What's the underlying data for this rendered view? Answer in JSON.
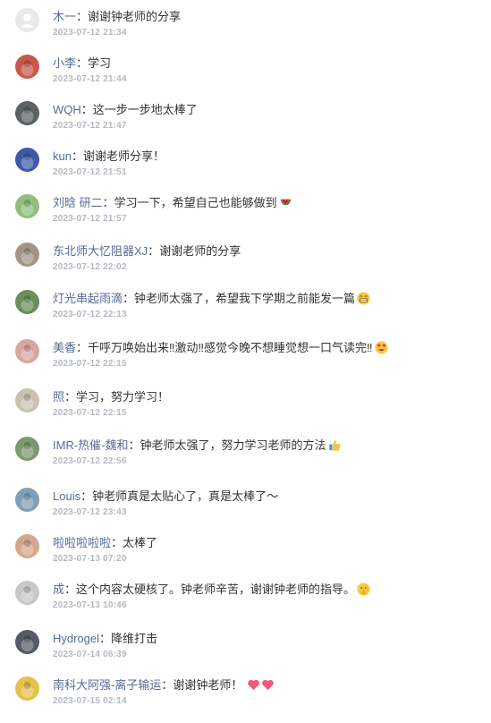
{
  "comments": [
    {
      "name": "木一",
      "text": "谢谢钟老师的分享",
      "time": "2023-07-12 21:34",
      "avatar_color": "#e6e6e6",
      "avatar_icon": "default-person-icon"
    },
    {
      "name": "小李",
      "text": "学习",
      "time": "2023-07-12 21:44",
      "avatar_color": "#c8574a",
      "avatar_icon": "bear-avatar-icon"
    },
    {
      "name": "WQH",
      "text": "这一步一步地太棒了",
      "time": "2023-07-12 21:47",
      "avatar_color": "#5c6163",
      "avatar_icon": "cat-avatar-icon"
    },
    {
      "name": "kun",
      "text": "谢谢老师分享！",
      "time": "2023-07-12 21:51",
      "avatar_color": "#3d5aa8",
      "avatar_icon": "photo-avatar-icon"
    },
    {
      "name": "刘晗 研二",
      "text": "学习一下，希望自己也能够做到",
      "time": "2023-07-12 21:57",
      "avatar_color": "#8fbf7a",
      "avatar_icon": "plant-avatar-icon",
      "emoji": "watermelon-emoji-icon"
    },
    {
      "name": "东北师大忆阻器XJ",
      "text": "谢谢老师的分享",
      "time": "2023-07-12 22:02",
      "avatar_color": "#a39585",
      "avatar_icon": "photo-avatar-icon"
    },
    {
      "name": "灯光串起雨滴",
      "text": "钟老师太强了，希望我下学期之前能发一篇",
      "time": "2023-07-12 22:13",
      "avatar_color": "#6a8f5a",
      "avatar_icon": "landscape-avatar-icon",
      "emoji": "grin-emoji-icon"
    },
    {
      "name": "美香",
      "text": "千呼万唤始出来‼激动‼感觉今晚不想睡觉想一口气读完‼",
      "time": "2023-07-12 22:15",
      "avatar_color": "#d9a5a0",
      "avatar_icon": "portrait-avatar-icon",
      "emoji": "heart-eyes-emoji-icon"
    },
    {
      "name": "照",
      "text": "学习，努力学习！",
      "time": "2023-07-12 22:15",
      "avatar_color": "#c9c1b0",
      "avatar_icon": "photo-avatar-icon"
    },
    {
      "name": "IMR-热催-魏和",
      "text": "钟老师太强了，努力学习老师的方法",
      "time": "2023-07-12 22:56",
      "avatar_color": "#7a9a6e",
      "avatar_icon": "photo-avatar-icon",
      "emoji": "thumbs-up-emoji-icon"
    },
    {
      "name": "Louis",
      "text": "钟老师真是太贴心了，真是太棒了～",
      "time": "2023-07-12 23:43",
      "avatar_color": "#7f9fb8",
      "avatar_icon": "city-avatar-icon"
    },
    {
      "name": "啦啦啦啦啦",
      "text": "太棒了",
      "time": "2023-07-13 07:20",
      "avatar_color": "#d3a88a",
      "avatar_icon": "sky-avatar-icon"
    },
    {
      "name": "成",
      "text": "这个内容太硬核了。钟老师辛苦，谢谢钟老师的指导。",
      "time": "2023-07-13 10:46",
      "avatar_color": "#c8c8c8",
      "avatar_icon": "photo-avatar-icon",
      "emoji": "shush-emoji-icon"
    },
    {
      "name": "Hydrogel",
      "text": "降维打击",
      "time": "2023-07-14 06:39",
      "avatar_color": "#555a66",
      "avatar_icon": "photo-avatar-icon"
    },
    {
      "name": "南科大阿强-离子输运",
      "text": "谢谢钟老师！",
      "time": "2023-07-15 02:14",
      "avatar_color": "#e3c14a",
      "avatar_icon": "pikachu-avatar-icon",
      "emoji": "two-hearts-emoji-icon"
    }
  ],
  "separator": "："
}
